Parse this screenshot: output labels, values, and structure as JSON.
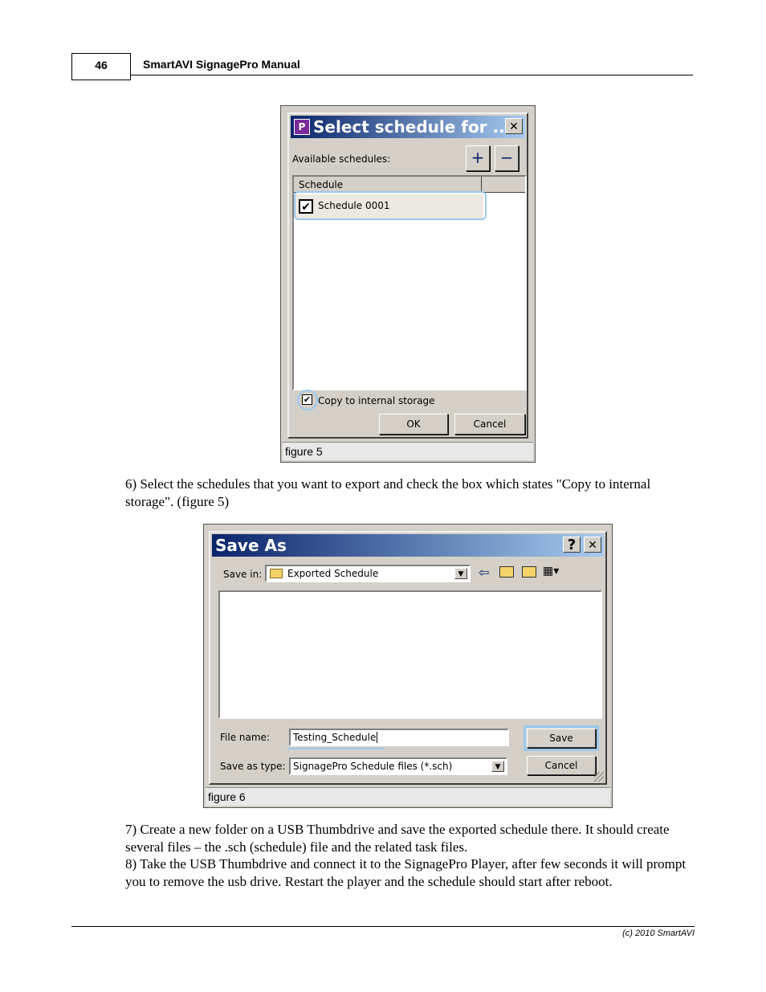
{
  "header": {
    "page_number": "46",
    "title": "SmartAVI SignagePro Manual"
  },
  "figure5": {
    "dialog_title": "Select schedule for ...",
    "available_label": "Available schedules:",
    "add_symbol": "+",
    "remove_symbol": "−",
    "close_symbol": "✕",
    "column_header": "Schedule",
    "schedule_item": "Schedule 0001",
    "copy_label": "Copy to internal storage",
    "ok_label": "OK",
    "cancel_label": "Cancel",
    "check_mark": "✔",
    "caption": "figure 5"
  },
  "paragraph1": "6) Select the schedules that you want to export and check the box which states \"Copy to internal storage\". (figure 5)",
  "figure6": {
    "dialog_title": "Save As",
    "help_symbol": "?",
    "close_symbol": "✕",
    "save_in_label": "Save in:",
    "save_in_value": "Exported Schedule",
    "file_name_label": "File name:",
    "file_name_value": "Testing_Schedule",
    "save_type_label": "Save as type:",
    "save_type_value": "SignagePro Schedule files (*.sch)",
    "save_label": "Save",
    "cancel_label": "Cancel",
    "caption": "figure 6"
  },
  "paragraph2": "7) Create a new folder on a USB Thumbdrive and save the exported schedule there. It should create several files – the .sch (schedule) file and the related task files.",
  "paragraph3": "8) Take the USB Thumbdrive and connect it to the SignagePro Player, after few seconds it will prompt you to remove the usb drive. Restart the player and the schedule should start after reboot.",
  "footer": {
    "copyright": "(c) 2010 SmartAVI"
  }
}
